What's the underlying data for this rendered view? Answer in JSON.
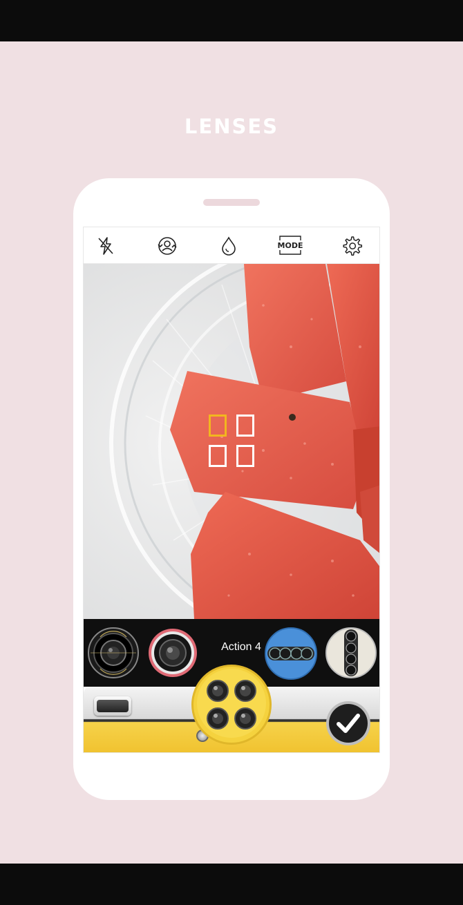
{
  "page": {
    "title": "LENSES"
  },
  "toolbar": {
    "flash_icon": "flash-off-icon",
    "camera_switch_icon": "camera-switch-icon",
    "filter_icon": "drop-icon",
    "mode_label": "MODE",
    "settings_icon": "gear-icon"
  },
  "focus_grid": {
    "active_cell": 1,
    "cells": 4
  },
  "lens_strip": {
    "selected_lens_label": "Action 4",
    "lenses": [
      "sprocket-lens",
      "red-ring-lens",
      "action-4-lens",
      "vertical-quad-lens"
    ]
  },
  "controls": {
    "shutter_icon": "quad-lens-shutter-icon",
    "confirm_icon": "check-icon"
  },
  "colors": {
    "background": "#f0e0e3",
    "accent_yellow": "#f2b61f",
    "bar_black": "#0c0c0c"
  }
}
